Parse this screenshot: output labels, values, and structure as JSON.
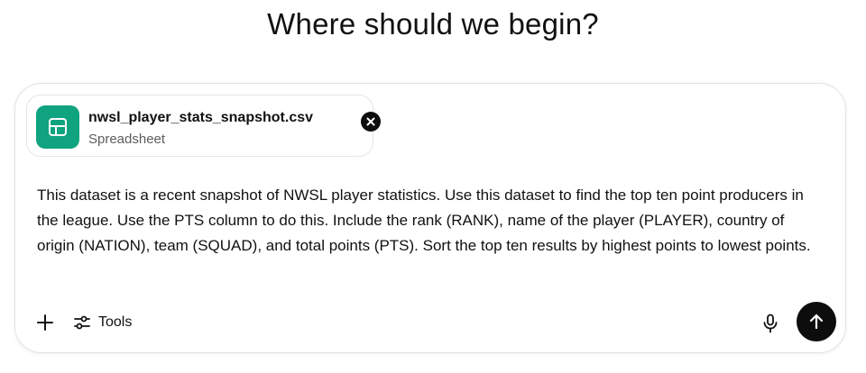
{
  "heading": "Where should we begin?",
  "attachment": {
    "file_name": "nwsl_player_stats_snapshot.csv",
    "file_type": "Spreadsheet",
    "icon": "spreadsheet-icon",
    "icon_color": "#10a37f"
  },
  "prompt": {
    "text": "This dataset is a recent snapshot of NWSL player statistics. Use this dataset to find the top ten point producers in the league. Use the PTS column to do this. Include the rank (RANK), name of the player (PLAYER), country of origin (NATION), team (SQUAD), and total points (PTS). Sort the top ten results by highest points to lowest points."
  },
  "toolbar": {
    "add_icon": "plus-icon",
    "tools_label": "Tools",
    "tools_icon": "sliders-icon",
    "mic_icon": "microphone-icon",
    "send_icon": "arrow-up-icon"
  }
}
